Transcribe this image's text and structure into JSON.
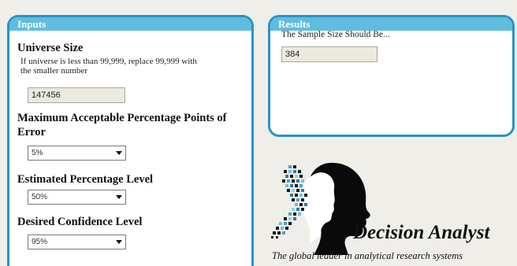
{
  "inputs": {
    "header": "Inputs",
    "universe_size": {
      "label": "Universe Size",
      "hint": "If universe is less than 99,999, replace 99,999 with the smaller number",
      "value": "147456"
    },
    "max_error": {
      "label": "Maximum Acceptable Percentage Points of Error",
      "selected": "5%"
    },
    "estimated_level": {
      "label": "Estimated Percentage Level",
      "selected": "50%"
    },
    "confidence_level": {
      "label": "Desired Confidence Level",
      "selected": "95%"
    }
  },
  "results": {
    "header": "Results",
    "label": "The Sample Size Should Be...",
    "value": "384"
  },
  "logo": {
    "name": "Decision Analyst",
    "tagline": "The global leader in analytical research systems"
  }
}
